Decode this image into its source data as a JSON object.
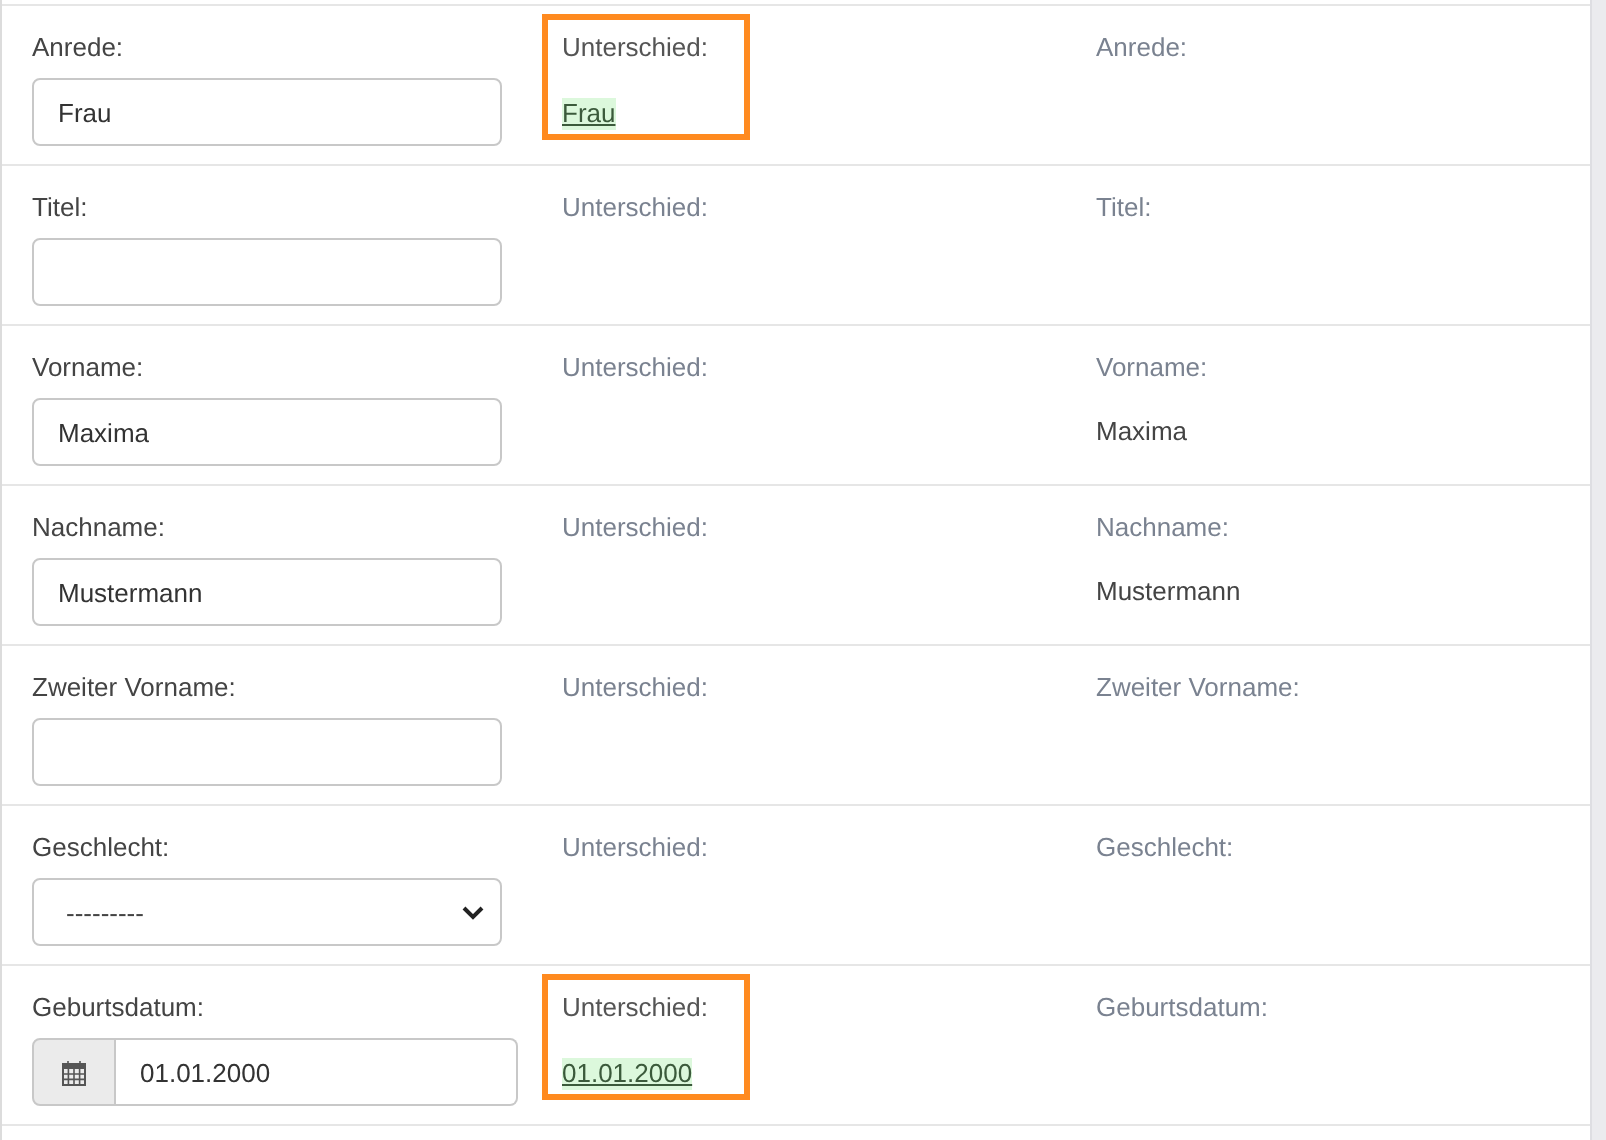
{
  "rows": [
    {
      "label": "Anrede:",
      "kind": "text",
      "value": "Frau",
      "diff_label": "Unterschied:",
      "highlighted": true,
      "diff_value": "Frau",
      "right_label": "Anrede:"
    },
    {
      "label": "Titel:",
      "kind": "text",
      "value": "",
      "diff_label": "Unterschied:",
      "highlighted": false,
      "right_label": "Titel:"
    },
    {
      "label": "Vorname:",
      "kind": "text",
      "value": "Maxima",
      "diff_label": "Unterschied:",
      "highlighted": false,
      "right_label": "Vorname:",
      "right_value": "Maxima"
    },
    {
      "label": "Nachname:",
      "kind": "text",
      "value": "Mustermann",
      "diff_label": "Unterschied:",
      "highlighted": false,
      "right_label": "Nachname:",
      "right_value": "Mustermann"
    },
    {
      "label": "Zweiter Vorname:",
      "kind": "text",
      "value": "",
      "diff_label": "Unterschied:",
      "highlighted": false,
      "right_label": "Zweiter Vorname:"
    },
    {
      "label": "Geschlecht:",
      "kind": "select",
      "value": "---------",
      "diff_label": "Unterschied:",
      "highlighted": false,
      "right_label": "Geschlecht:"
    },
    {
      "label": "Geburtsdatum:",
      "kind": "date",
      "value": "01.01.2000",
      "diff_label": "Unterschied:",
      "highlighted": true,
      "diff_value": "01.01.2000",
      "right_label": "Geburtsdatum:"
    }
  ]
}
